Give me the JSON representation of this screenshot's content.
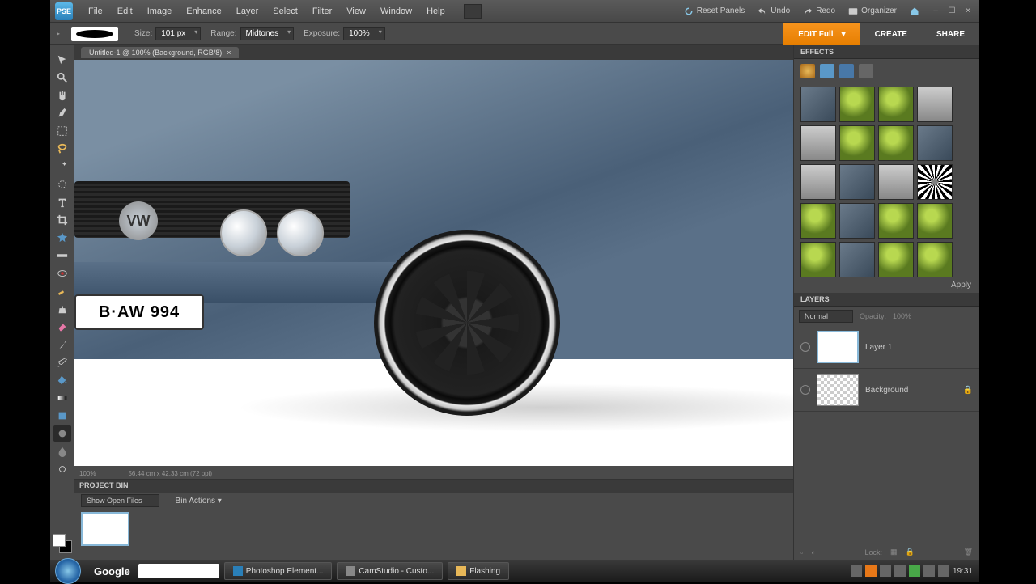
{
  "menubar": {
    "items": [
      "File",
      "Edit",
      "Image",
      "Enhance",
      "Layer",
      "Select",
      "Filter",
      "View",
      "Window",
      "Help"
    ],
    "reset": "Reset Panels",
    "undo": "Undo",
    "redo": "Redo",
    "organizer": "Organizer"
  },
  "optbar": {
    "size_label": "Size:",
    "size_val": "101 px",
    "range_label": "Range:",
    "range_val": "Midtones",
    "exposure_label": "Exposure:",
    "exposure_val": "100%"
  },
  "rbuttons": {
    "edit": "EDIT Full",
    "create": "CREATE",
    "share": "SHARE"
  },
  "tab": {
    "title": "Untitled-1 @ 100% (Background, RGB/8)",
    "close": "×"
  },
  "status": {
    "zoom": "100%",
    "dims": "56.44 cm x 42.33 cm (72 ppi)"
  },
  "projectbin": {
    "title": "PROJECT BIN",
    "show": "Show Open Files",
    "actions": "Bin Actions"
  },
  "effects": {
    "title": "EFFECTS",
    "apply": "Apply"
  },
  "layers": {
    "title": "LAYERS",
    "blend": "Normal",
    "opacity_label": "Opacity:",
    "opacity_val": "100%",
    "items": [
      {
        "name": "Layer 1",
        "locked": false
      },
      {
        "name": "Background",
        "locked": true
      }
    ],
    "lock_label": "Lock:"
  },
  "plate": "B·AW 994",
  "taskbar": {
    "google": "Google",
    "apps": [
      "Photoshop Element...",
      "CamStudio - Custo...",
      "Flashing"
    ],
    "time": "19:31"
  }
}
